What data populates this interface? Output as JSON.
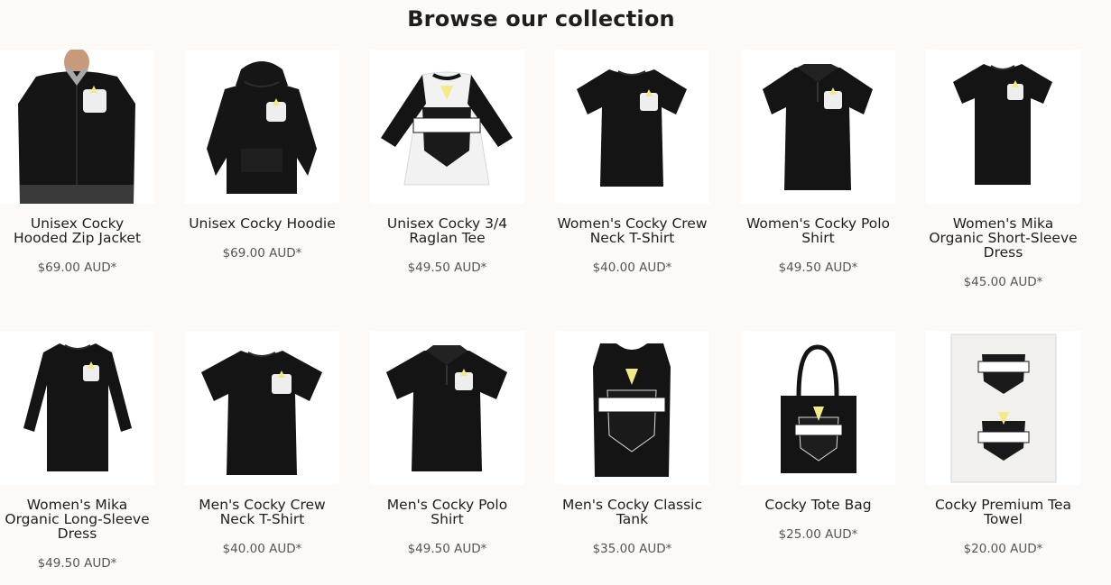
{
  "section": {
    "heading": "Browse our collection"
  },
  "products": [
    {
      "name": "Unisex Cocky Hooded Zip Jacket",
      "price": "$69.00 AUD*",
      "icon": "zip-jacket-image"
    },
    {
      "name": "Unisex Cocky Hoodie",
      "price": "$69.00 AUD*",
      "icon": "hoodie-image"
    },
    {
      "name": "Unisex Cocky 3/4 Raglan Tee",
      "price": "$49.50 AUD*",
      "icon": "raglan-tee-image"
    },
    {
      "name": "Women's Cocky Crew Neck T-Shirt",
      "price": "$40.00 AUD*",
      "icon": "womens-crew-tee-image"
    },
    {
      "name": "Women's Cocky Polo Shirt",
      "price": "$49.50 AUD*",
      "icon": "womens-polo-image"
    },
    {
      "name": "Women's Mika Organic Short-Sleeve Dress",
      "price": "$45.00 AUD*",
      "icon": "short-sleeve-dress-image"
    },
    {
      "name": "Women's Mika Organic Long-Sleeve Dress",
      "price": "$49.50 AUD*",
      "icon": "long-sleeve-dress-image"
    },
    {
      "name": "Men's Cocky Crew Neck T-Shirt",
      "price": "$40.00 AUD*",
      "icon": "mens-crew-tee-image"
    },
    {
      "name": "Men's Cocky Polo Shirt",
      "price": "$49.50 AUD*",
      "icon": "mens-polo-image"
    },
    {
      "name": "Men's Cocky Classic Tank",
      "price": "$35.00 AUD*",
      "icon": "tank-image"
    },
    {
      "name": "Cocky Tote Bag",
      "price": "$25.00 AUD*",
      "icon": "tote-bag-image"
    },
    {
      "name": "Cocky Premium Tea Towel",
      "price": "$20.00 AUD*",
      "icon": "tea-towel-image"
    }
  ],
  "colors": {
    "background": "#fdf9f6",
    "garment": "#111111",
    "logo_accent": "#f3e98a",
    "text": "#1e1e1e",
    "price_text": "#555555"
  }
}
